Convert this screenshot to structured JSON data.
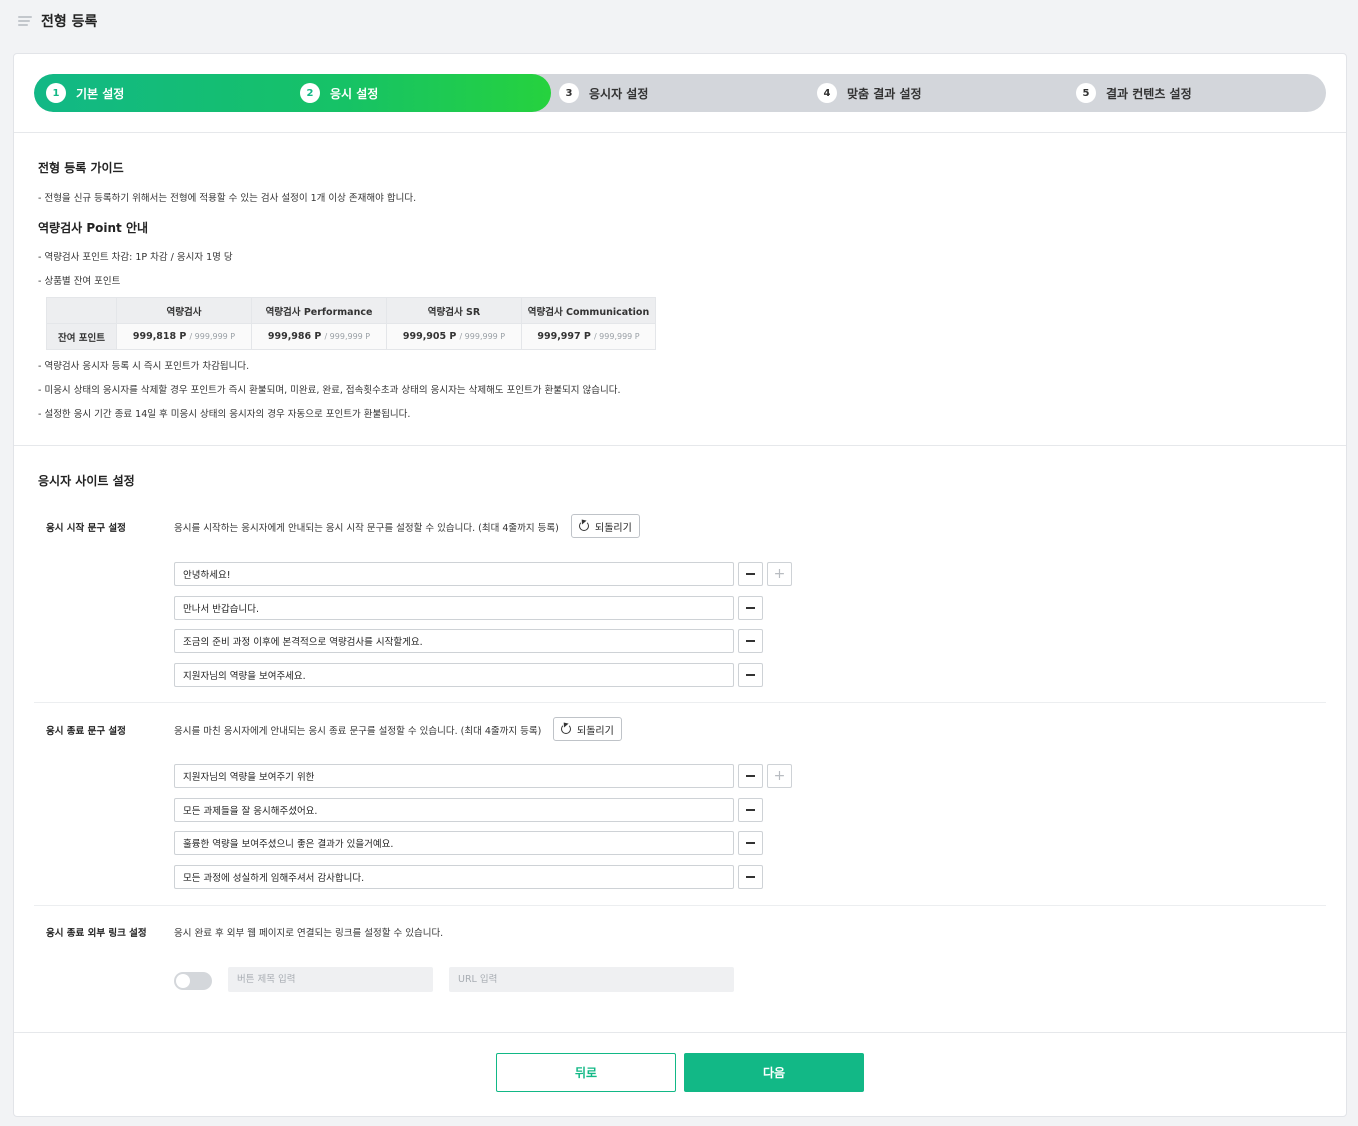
{
  "page_title": "전형 등록",
  "steps": [
    {
      "num": "1",
      "label": "기본 설정"
    },
    {
      "num": "2",
      "label": "응시 설정"
    },
    {
      "num": "3",
      "label": "응시자 설정"
    },
    {
      "num": "4",
      "label": "맞춤 결과 설정"
    },
    {
      "num": "5",
      "label": "결과 컨텐츠 설정"
    }
  ],
  "guide": {
    "title": "전형 등록 가이드",
    "note": "- 전형을 신규 등록하기 위해서는 전형에 적용할 수 있는 검사 설정이 1개 이상 존재해야 합니다."
  },
  "points": {
    "title": "역량검사 Point 안내",
    "notes_top": [
      "- 역량검사 포인트 차감: 1P 차감 / 응시자 1명 당",
      "- 상품별 잔여 포인트"
    ],
    "table": {
      "row_header": "잔여 포인트",
      "columns": [
        "역량검사",
        "역량검사 Performance",
        "역량검사 SR",
        "역량검사 Communication"
      ],
      "values": [
        {
          "current": "999,818 P",
          "max": "/ 999,999 P"
        },
        {
          "current": "999,986 P",
          "max": "/ 999,999 P"
        },
        {
          "current": "999,905 P",
          "max": "/ 999,999 P"
        },
        {
          "current": "999,997 P",
          "max": "/ 999,999 P"
        }
      ]
    },
    "notes_bottom": [
      "- 역량검사 응시자 등록 시 즉시 포인트가 차감됩니다.",
      "- 미응시 상태의 응시자를 삭제할 경우 포인트가 즉시 환불되며, 미완료, 완료, 접속횟수초과 상태의 응시자는 삭제해도 포인트가 환불되지 않습니다.",
      "- 설정한 응시 기간 종료 14일 후 미응시 상태의 응시자의 경우 자동으로 포인트가 환불됩니다."
    ]
  },
  "site": {
    "title": "응시자 사이트 설정",
    "reset_label": "되돌리기",
    "start": {
      "label": "응시 시작 문구 설정",
      "desc": "응시를 시작하는 응시자에게 안내되는 응시 시작 문구를 설정할 수 있습니다. (최대 4줄까지 등록)",
      "lines": [
        "안녕하세요!",
        "만나서 반갑습니다.",
        "조금의 준비 과정 이후에 본격적으로 역량검사를 시작할게요.",
        "지원자님의 역량을 보여주세요."
      ]
    },
    "end": {
      "label": "응시 종료 문구 설정",
      "desc": "응시를 마친 응시자에게 안내되는 응시 종료 문구를 설정할 수 있습니다. (최대 4줄까지 등록)",
      "lines": [
        "지원자님의 역량을 보여주기 위한",
        "모든 과제들을 잘 응시해주셨어요.",
        "훌륭한 역량을 보여주셨으니 좋은 결과가 있을거예요.",
        "모든 과정에 성실하게 임해주셔서 감사합니다."
      ]
    },
    "link": {
      "label": "응시 종료 외부 링크 설정",
      "desc": "응시 완료 후 외부 웹 페이지로 연결되는 링크를 설정할 수 있습니다.",
      "toggle_on": false,
      "button_title_placeholder": "버튼 제목 입력",
      "url_placeholder": "URL 입력"
    }
  },
  "footer": {
    "back_label": "뒤로",
    "next_label": "다음"
  },
  "colors": {
    "accent": "#12b886",
    "progress_end": "#26d23e",
    "step_inactive": "#d3d6db"
  }
}
